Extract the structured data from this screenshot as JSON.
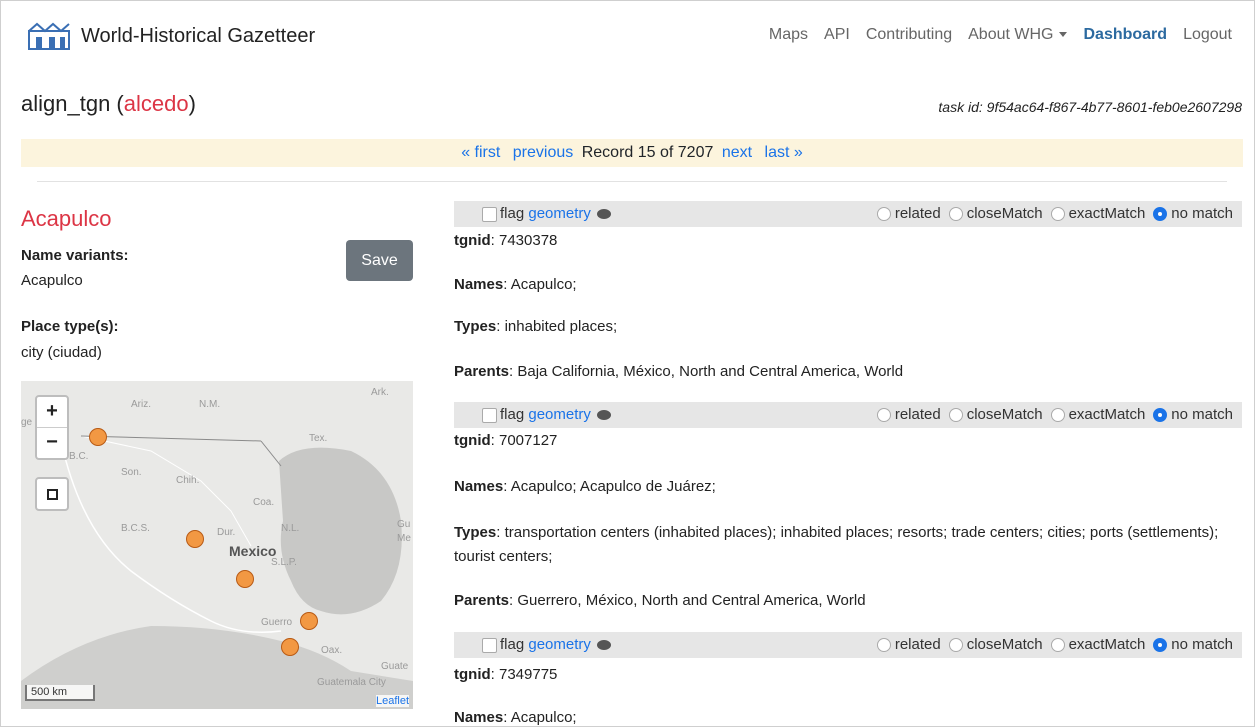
{
  "app": {
    "title": "World-Historical Gazetteer"
  },
  "nav": [
    "Maps",
    "API",
    "Contributing",
    "About WHG",
    "Dashboard",
    "Logout"
  ],
  "task": {
    "name": "align_tgn",
    "dataset": "alcedo",
    "id_label": "task id:",
    "id": "9f54ac64-f867-4b77-8601-feb0e2607298"
  },
  "pager": {
    "first": "« first",
    "previous": "previous",
    "record": "Record 15 of 7207",
    "next": "next",
    "last": "last »"
  },
  "place": {
    "title": "Acapulco",
    "variants_label": "Name variants:",
    "variants": "Acapulco",
    "types_label": "Place type(s):",
    "types": "city (ciudad)",
    "save": "Save"
  },
  "map": {
    "zoom_in": "+",
    "zoom_out": "−",
    "country_label": "Mexico",
    "labels": [
      "Ariz.",
      "N.M.",
      "Tex.",
      "Ark.",
      "Son.",
      "Chih.",
      "Coa.",
      "N.L.",
      "Dur.",
      "B.C.S.",
      "S.L.P.",
      "Guerro",
      "Oax.",
      "B.C.",
      "Gu",
      "Me",
      "Guate",
      "Guatemala City",
      "ge"
    ],
    "scale": "500 km",
    "attribution": "Leaflet"
  },
  "match_controls": {
    "flag": "flag",
    "geometry": "geometry",
    "options": [
      "related",
      "closeMatch",
      "exactMatch",
      "no match"
    ],
    "selected": "no match"
  },
  "field_labels": {
    "tgnid": "tgnid",
    "names": "Names",
    "types": "Types",
    "parents": "Parents"
  },
  "matches": [
    {
      "tgnid": "7430378",
      "names": "Acapulco;",
      "types": "inhabited places;",
      "parents": "Baja California, México, North and Central America, World"
    },
    {
      "tgnid": "7007127",
      "names": "Acapulco; Acapulco de Juárez;",
      "types": "transportation centers (inhabited places); inhabited places; resorts; trade centers; cities; ports (settlements); tourist centers;",
      "parents": "Guerrero, México, North and Central America, World"
    },
    {
      "tgnid": "7349775",
      "names": "Acapulco;"
    }
  ]
}
